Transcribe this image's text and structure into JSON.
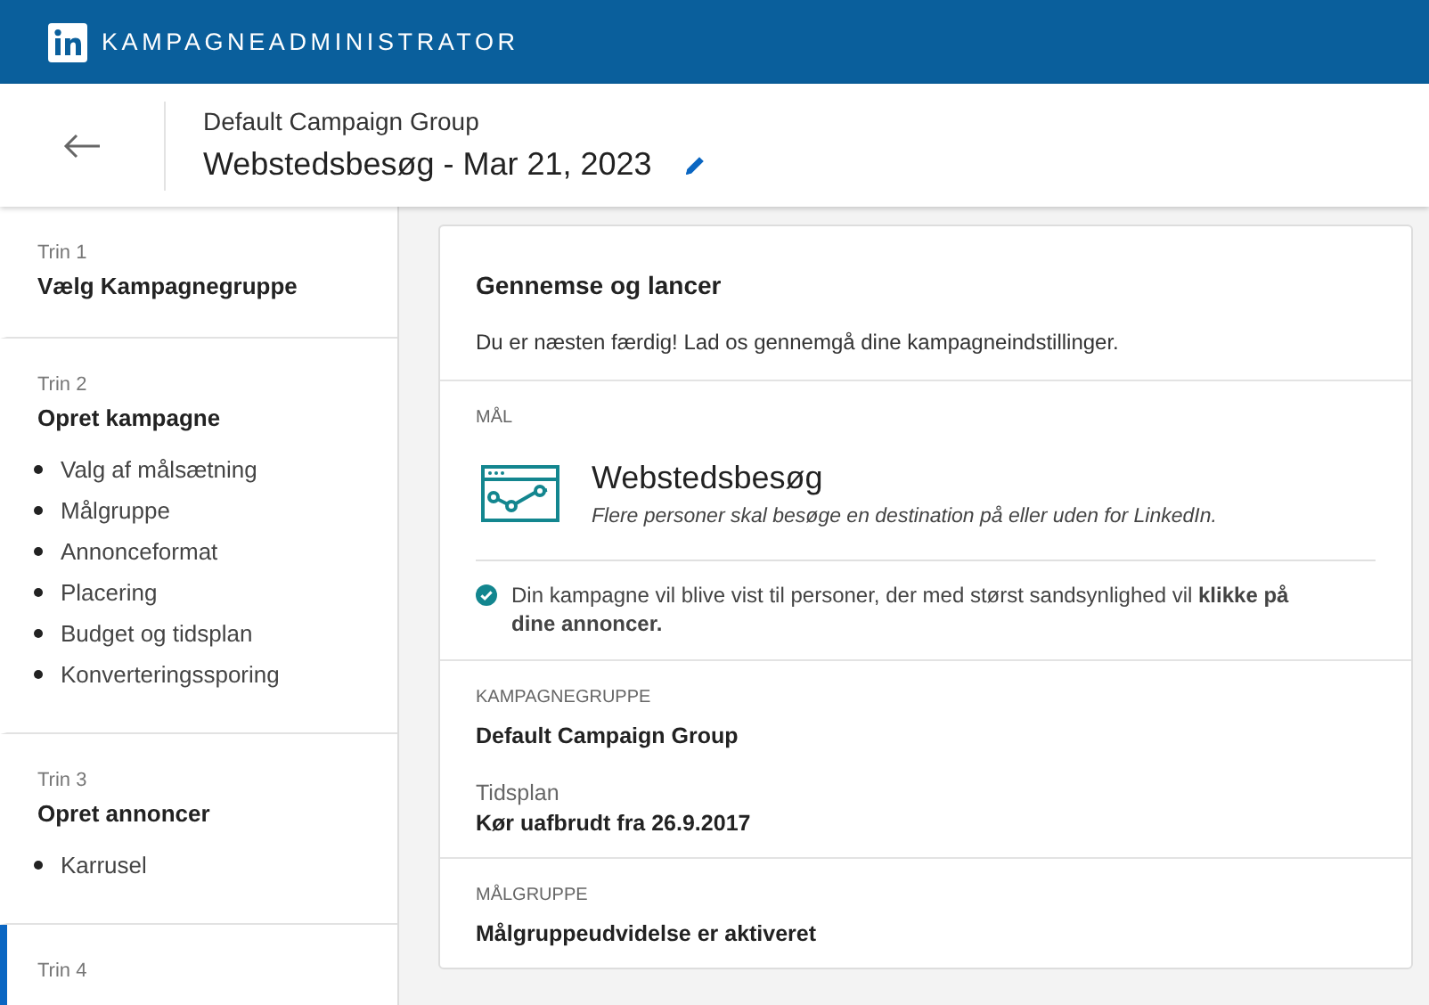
{
  "top_bar": {
    "title": "KAMPAGNEADMINISTRATOR"
  },
  "header": {
    "group": "Default Campaign Group",
    "campaign_name": "Webstedsbesøg - Mar 21, 2023"
  },
  "steps": [
    {
      "label": "Trin 1",
      "title": "Vælg Kampagnegruppe",
      "selected": false
    },
    {
      "label": "Trin 2",
      "title": "Opret kampagne",
      "selected": false,
      "items": [
        "Valg af målsætning",
        "Målgruppe",
        "Annonceformat",
        "Placering",
        "Budget og tidsplan",
        "Konverteringssporing"
      ]
    },
    {
      "label": "Trin 3",
      "title": "Opret annoncer",
      "selected": false,
      "items": [
        "Karrusel"
      ]
    },
    {
      "label": "Trin 4",
      "selected": true
    }
  ],
  "review": {
    "title": "Gennemse og lancer",
    "intro": "Du er næsten færdig! Lad os gennemgå dine kampagneindstillinger.",
    "goal": {
      "heading": "MÅL",
      "name": "Webstedsbesøg",
      "description": "Flere personer skal besøge en destination på eller uden for LinkedIn.",
      "note": "Din kampagne vil blive vist til personer, der med størst sandsynlighed vil **klikke på dine annoncer.**"
    },
    "campaign_group": {
      "heading": "KAMPAGNEGRUPPE",
      "value": "Default Campaign Group",
      "schedule_label": "Tidsplan",
      "schedule_value": "Kør uafbrudt fra 26.9.2017"
    },
    "audience": {
      "heading": "MÅLGRUPPE",
      "value": "Målgruppeudvidelse er aktiveret"
    }
  }
}
